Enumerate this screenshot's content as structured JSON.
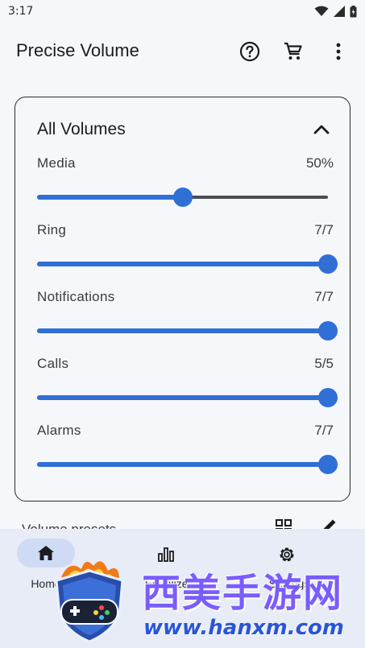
{
  "status_bar": {
    "time": "3:17"
  },
  "app_bar": {
    "title": "Precise Volume"
  },
  "card": {
    "title": "All Volumes",
    "volumes": [
      {
        "label": "Media",
        "value": "50%",
        "level": 0.5
      },
      {
        "label": "Ring",
        "value": "7/7",
        "level": 1.0
      },
      {
        "label": "Notifications",
        "value": "7/7",
        "level": 1.0
      },
      {
        "label": "Calls",
        "value": "5/5",
        "level": 1.0
      },
      {
        "label": "Alarms",
        "value": "7/7",
        "level": 1.0
      }
    ]
  },
  "presets": {
    "label": "Volume presets"
  },
  "bottom_nav": {
    "items": [
      {
        "label": "Home",
        "icon": "home-icon"
      },
      {
        "label": "Equalizer",
        "icon": "equalizer-icon"
      },
      {
        "label": "Settings",
        "icon": "gear-icon"
      }
    ]
  },
  "watermark": {
    "title": "西美手游网",
    "url": "www.hanxm.com"
  },
  "colors": {
    "accent": "#2f6fd6",
    "background": "#f6f7fb",
    "nav_background": "#e8ecf6",
    "nav_pill": "#cfdaf4"
  }
}
